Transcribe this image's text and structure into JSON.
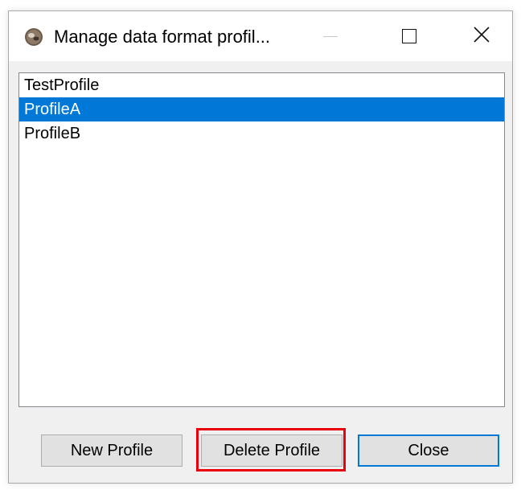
{
  "window": {
    "title": "Manage data format profil...",
    "app_icon": "app-logo-icon",
    "controls": [
      "minimize-icon",
      "maximize-icon",
      "close-icon"
    ]
  },
  "profiles": [
    {
      "label": "TestProfile",
      "selected": false
    },
    {
      "label": "ProfileA",
      "selected": true
    },
    {
      "label": "ProfileB",
      "selected": false
    }
  ],
  "buttons": {
    "new_label": "New Profile",
    "delete_label": "Delete Profile",
    "close_label": "Close"
  },
  "colors": {
    "selection": "#0078d7",
    "highlight_box": "#e8000d",
    "default_button_border": "#0078d7"
  }
}
